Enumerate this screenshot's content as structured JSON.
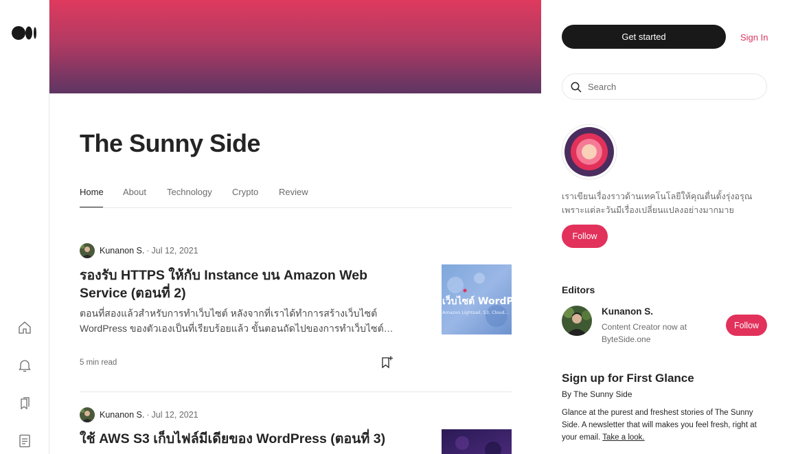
{
  "rail": {
    "icons": [
      "medium-logo",
      "home-icon",
      "notifications-icon",
      "lists-icon",
      "stories-icon"
    ]
  },
  "publication": {
    "title": "The Sunny Side",
    "description": "เราเขียนเรื่องราวด้านเทคโนโลยีให้คุณตื่นตั้งรุ่งอรุณ เพราะแต่ละวันมีเรื่องเปลี่ยนแปลงอย่างมากมาย",
    "hero_colors": [
      "#df3a5e",
      "#5e3563"
    ]
  },
  "tabs": [
    {
      "label": "Home",
      "active": true
    },
    {
      "label": "About",
      "active": false
    },
    {
      "label": "Technology",
      "active": false
    },
    {
      "label": "Crypto",
      "active": false
    },
    {
      "label": "Review",
      "active": false
    }
  ],
  "posts": [
    {
      "author": "Kunanon S.",
      "date": "Jul 12, 2021",
      "title": "รองรับ HTTPS ให้กับ Instance บน Amazon Web Service (ตอนที่ 2)",
      "excerpt": "ตอนที่สองแล้วสำหรับการทำเว็บไซต์ หลังจากที่เราได้ทำการสร้างเว็บไซต์ WordPress ของตัวเองเป็นที่เรียบร้อยแล้ว ขั้นตอนถัดไปของการทำเว็บไซต์ให้...",
      "read_time": "5 min read",
      "thumbnail_text": "เว็บไซต์ WordP",
      "thumbnail_subtext": "Amazon Lightsail, S3, Cloud..."
    },
    {
      "author": "Kunanon S.",
      "date": "Jul 12, 2021",
      "title": "ใช้ AWS S3 เก็บไฟล์มีเดียของ WordPress (ตอนที่ 3)"
    }
  ],
  "sidebar": {
    "get_started": "Get started",
    "sign_in": "Sign In",
    "search_placeholder": "Search",
    "follow_label": "Follow",
    "editors_heading": "Editors",
    "editor": {
      "name": "Kunanon S.",
      "bio": "Content Creator now at ByteSide.one",
      "follow_label": "Follow"
    },
    "signup": {
      "heading": "Sign up for First Glance",
      "by": "By The Sunny Side",
      "description": "Glance at the purest and freshest stories of The Sunny Side. A newsletter that will makes you feel fresh, right at your email.",
      "link": "Take a look."
    }
  },
  "colors": {
    "accent": "#e2315a",
    "signin": "#d6355f",
    "dark_button": "#191919"
  }
}
